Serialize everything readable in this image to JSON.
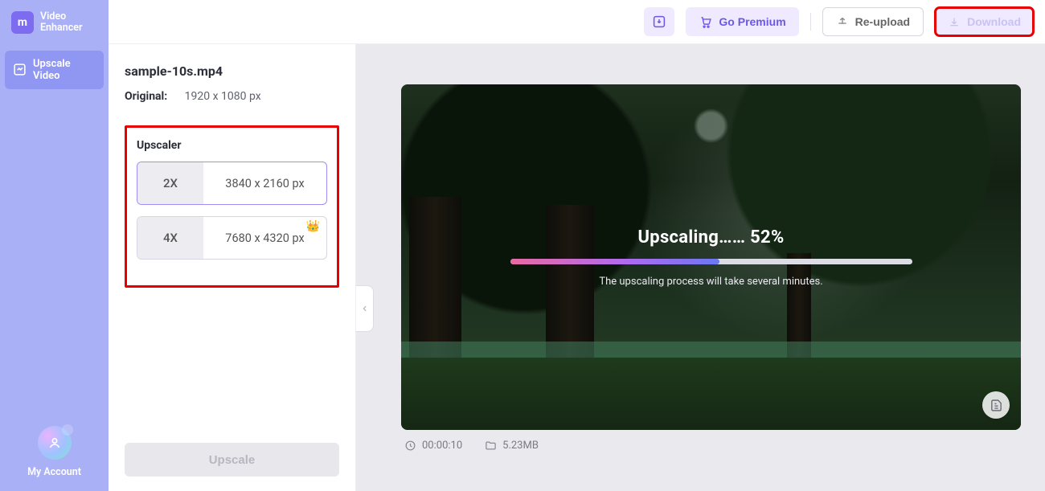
{
  "app": {
    "name_line1": "Video",
    "name_line2": "Enhancer",
    "logo_letter": "m"
  },
  "sidebar": {
    "nav": [
      {
        "label": "Upscale Video"
      }
    ],
    "account_label": "My Account"
  },
  "topbar": {
    "premium_label": "Go Premium",
    "reupload_label": "Re-upload",
    "download_label": "Download"
  },
  "panel": {
    "filename": "sample-10s.mp4",
    "original_label": "Original:",
    "original_value": "1920 x 1080 px",
    "upscaler_heading": "Upscaler",
    "options": [
      {
        "mult": "2X",
        "dim": "3840 x 2160 px",
        "selected": true,
        "premium": false
      },
      {
        "mult": "4X",
        "dim": "7680 x 4320 px",
        "selected": false,
        "premium": true
      }
    ],
    "upscale_button": "Upscale"
  },
  "preview": {
    "progress_label_prefix": "Upscaling……",
    "progress_percent": "52%",
    "progress_value": 52,
    "progress_hint": "The upscaling process will take several minutes.",
    "duration": "00:00:10",
    "filesize": "5.23MB"
  }
}
